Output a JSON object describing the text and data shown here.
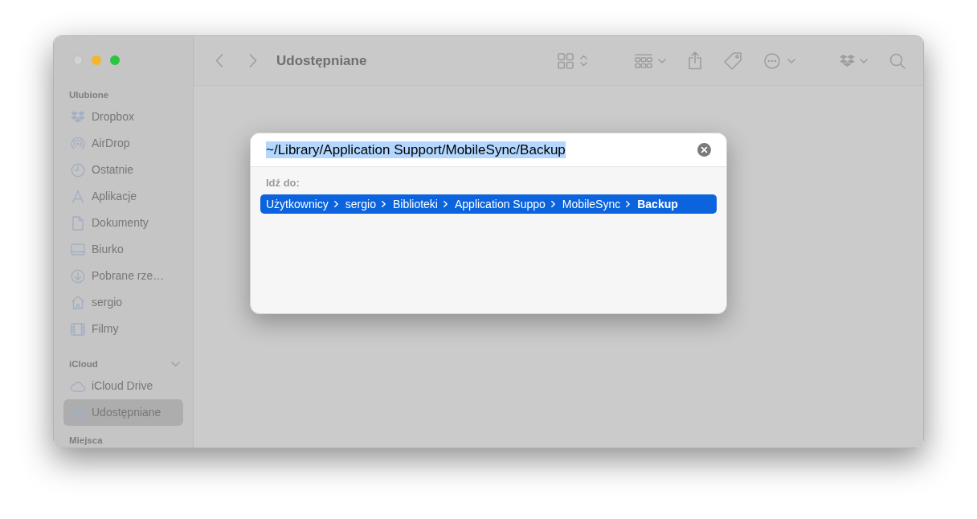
{
  "window": {
    "title": "Udostępniane"
  },
  "window_controls": [
    {
      "kind": "close",
      "disabled": true
    },
    {
      "kind": "minimize",
      "disabled": false
    },
    {
      "kind": "zoom",
      "disabled": false
    }
  ],
  "sidebar": {
    "sections": [
      {
        "title": "Ulubione",
        "items": [
          {
            "label": "Dropbox",
            "kind": "dropbox",
            "selected": false
          },
          {
            "label": "AirDrop",
            "kind": "airdrop",
            "selected": false
          },
          {
            "label": "Ostatnie",
            "kind": "recents",
            "selected": false
          },
          {
            "label": "Aplikacje",
            "kind": "applications",
            "selected": false
          },
          {
            "label": "Dokumenty",
            "kind": "documents",
            "selected": false
          },
          {
            "label": "Biurko",
            "kind": "desktop",
            "selected": false
          },
          {
            "label": "Pobrane rze…",
            "kind": "downloads",
            "selected": false
          },
          {
            "label": "sergio",
            "kind": "home",
            "selected": false
          },
          {
            "label": "Filmy",
            "kind": "movies",
            "selected": false
          }
        ]
      },
      {
        "title": "iCloud",
        "expanded": true,
        "items": [
          {
            "label": "iCloud Drive",
            "kind": "cloud",
            "selected": false
          },
          {
            "label": "Udostępniane",
            "kind": "shared",
            "selected": true
          }
        ]
      },
      {
        "title": "Miejsca"
      }
    ]
  },
  "dialog": {
    "path": "~/Library/Application Support/MobileSync/Backup",
    "path_selected": true,
    "label": "Idź do:",
    "results": [
      {
        "selected": true,
        "segments": [
          {
            "label": "Użytkownicy",
            "current": false
          },
          {
            "label": "sergio",
            "current": false
          },
          {
            "label": "Biblioteki",
            "current": false
          },
          {
            "label": "Application Suppo",
            "current": false
          },
          {
            "label": "MobileSync",
            "current": false
          },
          {
            "label": "Backup",
            "current": true
          }
        ]
      }
    ]
  }
}
